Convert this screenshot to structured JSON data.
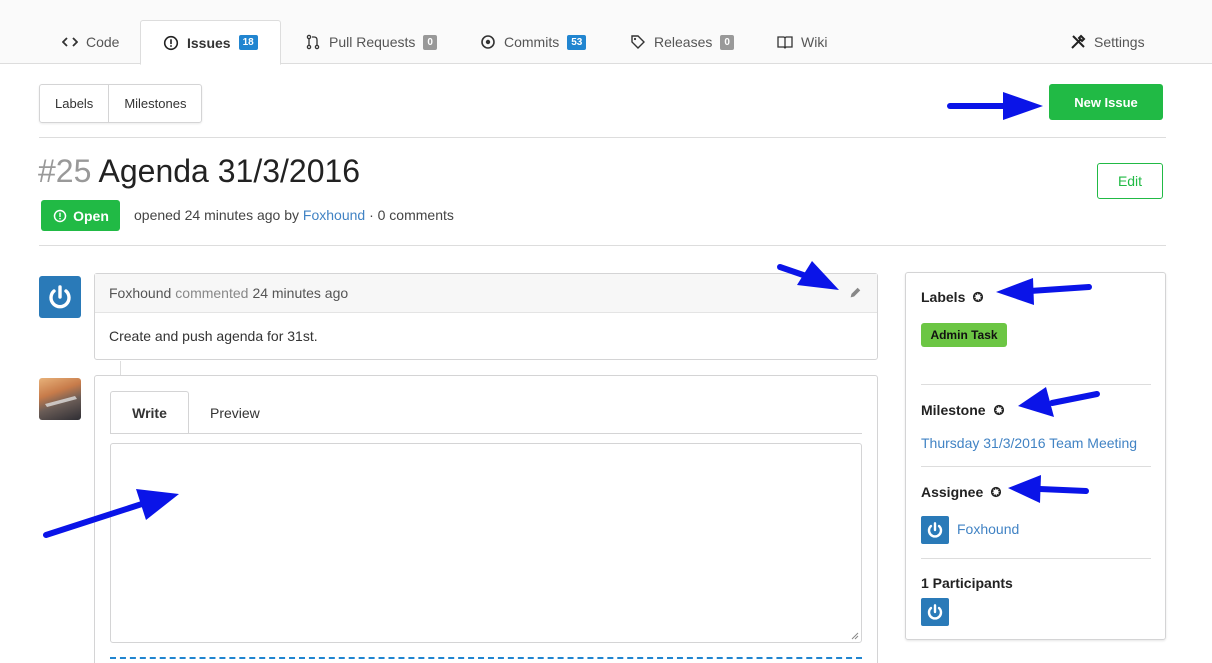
{
  "nav": {
    "tabs": [
      {
        "label": "Code",
        "icon": "code-icon"
      },
      {
        "label": "Issues",
        "icon": "issue-icon",
        "badge": "18"
      },
      {
        "label": "Pull Requests",
        "icon": "pull-request-icon",
        "badge": "0"
      },
      {
        "label": "Commits",
        "icon": "commit-icon",
        "badge": "53"
      },
      {
        "label": "Releases",
        "icon": "tag-icon",
        "badge": "0"
      },
      {
        "label": "Wiki",
        "icon": "book-icon"
      }
    ],
    "settings_label": "Settings"
  },
  "toolbar": {
    "labels_label": "Labels",
    "milestones_label": "Milestones",
    "new_issue_label": "New Issue"
  },
  "issue": {
    "number": "#25",
    "title": "Agenda 31/3/2016",
    "edit_label": "Edit",
    "status": "Open",
    "opened_text": "opened 24 minutes ago by",
    "author": "Foxhound",
    "comments_text": "· 0 comments"
  },
  "comment": {
    "author": "Foxhound",
    "action": "commented",
    "time": "24 minutes ago",
    "body": "Create and push agenda for 31st."
  },
  "editor": {
    "write_tab": "Write",
    "preview_tab": "Preview",
    "text_value": ""
  },
  "sidebar": {
    "labels_title": "Labels",
    "label_tag": "Admin Task",
    "milestone_title": "Milestone",
    "milestone_value": "Thursday 31/3/2016 Team Meeting",
    "assignee_title": "Assignee",
    "assignee_name": "Foxhound",
    "participants_title": "1 Participants"
  },
  "colors": {
    "green": "#21ba45",
    "blue_badge": "#2185d0",
    "link": "#4183c4",
    "label_green": "#6cc644",
    "annotation_arrow": "#0a14e8"
  }
}
